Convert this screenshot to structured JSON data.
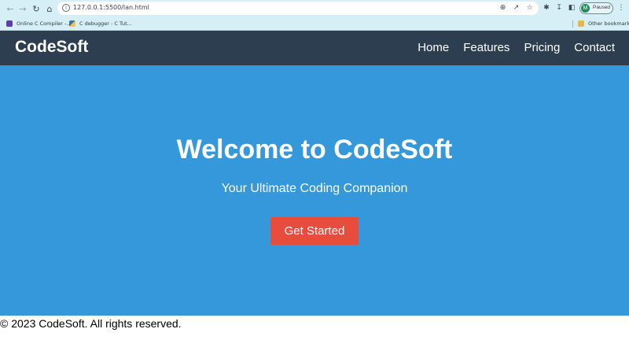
{
  "browser": {
    "url": "127.0.0.1:5500/lan.html",
    "profile": {
      "initial": "M",
      "status": "Paused"
    },
    "bookmarks": [
      {
        "label": "Online C Compiler -..."
      },
      {
        "label": "C debugger - C Tut..."
      }
    ],
    "other_bookmarks": "Other bookmarks"
  },
  "header": {
    "brand": "CodeSoft",
    "nav": [
      "Home",
      "Features",
      "Pricing",
      "Contact"
    ]
  },
  "hero": {
    "title": "Welcome to CodeSoft",
    "subtitle": "Your Ultimate Coding Companion",
    "cta_label": "Get Started"
  },
  "footer": {
    "text": "© 2023 CodeSoft. All rights reserved."
  },
  "colors": {
    "header_bg": "#2c3e50",
    "hero_bg": "#3498db",
    "cta_bg": "#e74c3c"
  }
}
